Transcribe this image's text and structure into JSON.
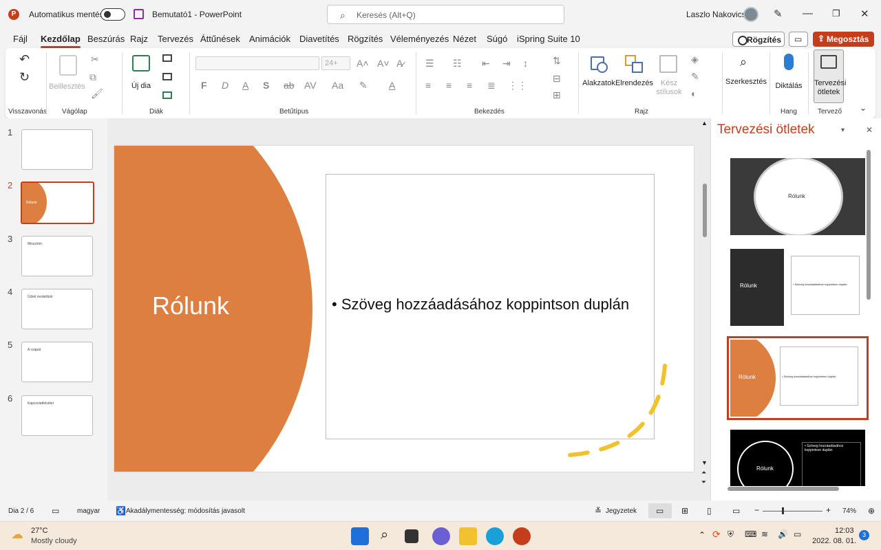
{
  "titlebar": {
    "app_icon": "P",
    "autosave_label": "Automatikus mentés",
    "doc_title": "Bemutató1  -  PowerPoint",
    "search_placeholder": "Keresés (Alt+Q)",
    "user_name": "Laszlo Nakovics"
  },
  "menu": {
    "tabs": [
      "Fájl",
      "Kezdőlap",
      "Beszúrás",
      "Rajz",
      "Tervezés",
      "Áttűnések",
      "Animációk",
      "Diavetítés",
      "Rögzítés",
      "Véleményezés",
      "Nézet",
      "Súgó",
      "iSpring Suite 10"
    ],
    "active": "Kezdőlap",
    "record_label": "Rögzítés",
    "share_label": "Megosztás"
  },
  "ribbon": {
    "groups": {
      "undo": "Visszavonás",
      "clipboard": "Vágólap",
      "slides": "Diák",
      "font": "Betűtípus",
      "paragraph": "Bekezdés",
      "drawing": "Rajz",
      "voice": "Hang",
      "designer": "Tervező"
    },
    "paste_label": "Beillesztés",
    "new_slide_label": "Új dia",
    "font_size": "24+",
    "font_buttons": {
      "bold": "F",
      "italic": "D",
      "underline": "A",
      "strike": "S",
      "aa": "Aa"
    },
    "shapes_label": "Alakzatok",
    "arrange_label": "Elrendezés",
    "quick_styles_label": "Kész stílusok",
    "editing_label": "Szerkesztés",
    "dictate_label": "Diktálás",
    "designer_btn_label": "Tervezési ötletek"
  },
  "slides_panel": {
    "slides": [
      {
        "num": "1",
        "title": ""
      },
      {
        "num": "2",
        "title": "Rólunk"
      },
      {
        "num": "3",
        "title": "Misszióm"
      },
      {
        "num": "4",
        "title": "Üzleti modellünk"
      },
      {
        "num": "5",
        "title": "A csapat"
      },
      {
        "num": "6",
        "title": "Kapcsolatfelvétel"
      }
    ],
    "selected": 2
  },
  "slide": {
    "title": "Rólunk",
    "bullet": "Szöveg hozzáadásához koppintson duplán",
    "accent_color": "#dd7f40",
    "dash_color": "#f2c12e"
  },
  "designer": {
    "title": "Tervezési ötletek",
    "options": [
      {
        "title": "Rólunk",
        "text": ""
      },
      {
        "title": "Rólunk",
        "text": "Szöveg hozzáadásához koppintson duplán"
      },
      {
        "title": "Rólunk",
        "text": "Szöveg hozzáadásához koppintson duplán"
      },
      {
        "title": "Rólunk",
        "text": "Szöveg hozzáadásához koppintson duplán"
      }
    ]
  },
  "status": {
    "slide_counter": "Dia 2 / 6",
    "language": "magyar",
    "accessibility": "Akadálymentesség: módosítás javasolt",
    "notes_label": "Jegyzetek",
    "zoom": "74%"
  },
  "taskbar": {
    "weather_temp": "27°C",
    "weather_desc": "Mostly cloudy",
    "time": "12:03",
    "date": "2022. 08. 01.",
    "notif_count": "3"
  },
  "colors": {
    "accent": "#c43e1c",
    "slide_orange": "#dd7f40"
  }
}
